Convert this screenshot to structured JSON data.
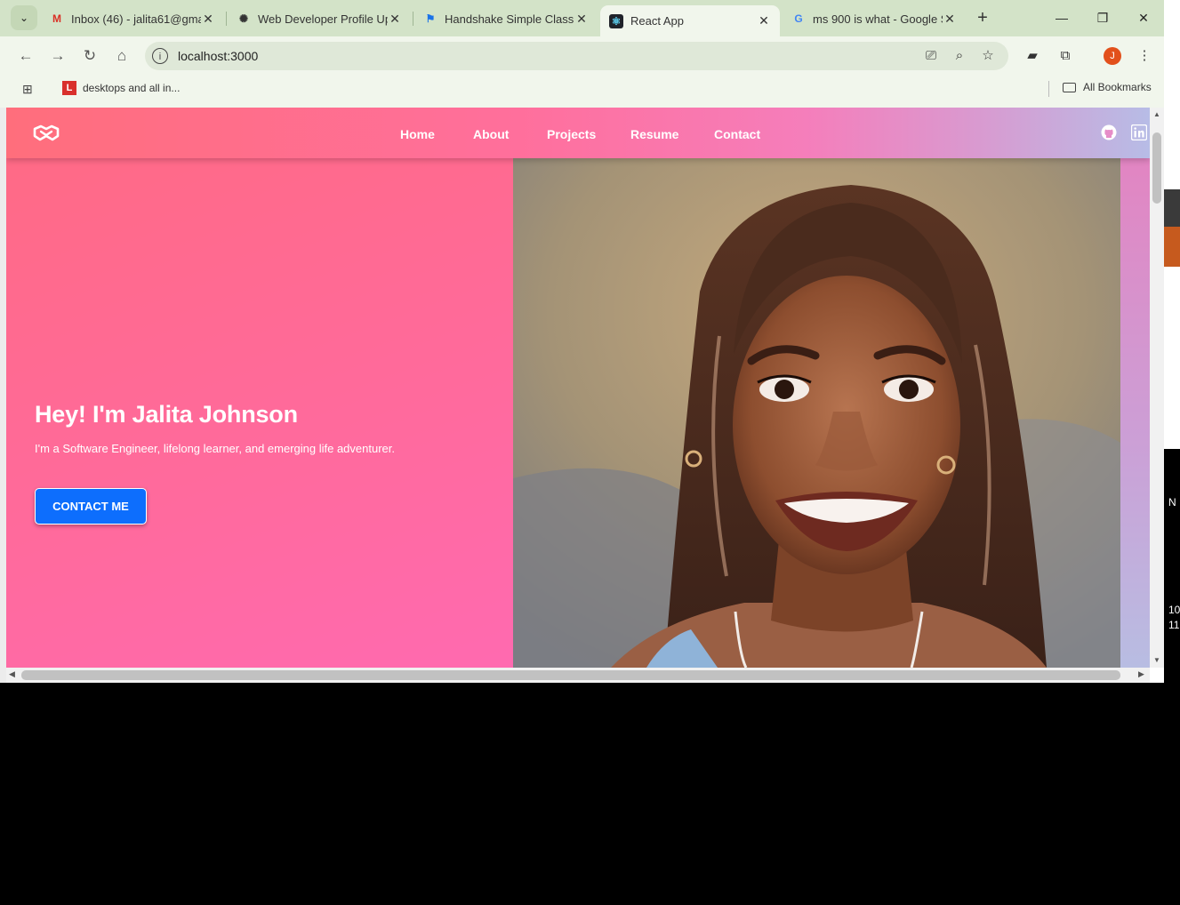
{
  "browser": {
    "tabs": [
      {
        "title": "Inbox (46) - jalita61@gma",
        "icon": "gmail-icon",
        "active": false
      },
      {
        "title": "Web Developer Profile Up",
        "icon": "chatgpt-icon",
        "active": false
      },
      {
        "title": "Handshake Simple Classic",
        "icon": "flag-icon",
        "active": false
      },
      {
        "title": "React App",
        "icon": "react-icon",
        "active": true
      },
      {
        "title": "ms 900 is what - Google S",
        "icon": "google-icon",
        "active": false
      }
    ],
    "url": "localhost:3000",
    "profile_initial": "J",
    "bookmarks": [
      {
        "label": "desktops and all in...",
        "icon_letter": "L"
      }
    ],
    "all_bookmarks_label": "All Bookmarks"
  },
  "site": {
    "nav": {
      "links": [
        "Home",
        "About",
        "Projects",
        "Resume",
        "Contact"
      ]
    },
    "hero": {
      "title": "Hey! I'm Jalita Johnson",
      "subtitle": "I'm a Software Engineer, lifelong learner, and emerging life adventurer.",
      "cta_label": "CONTACT ME"
    }
  },
  "background_window": {
    "fragments": [
      "N",
      "10",
      "11"
    ]
  },
  "colors": {
    "nav_start": "#ff6e7c",
    "nav_end": "#b7bce6",
    "hero_pink": "#ff6a9e",
    "cta_blue": "#0d6efd",
    "chrome_green": "#d3e3c8"
  }
}
